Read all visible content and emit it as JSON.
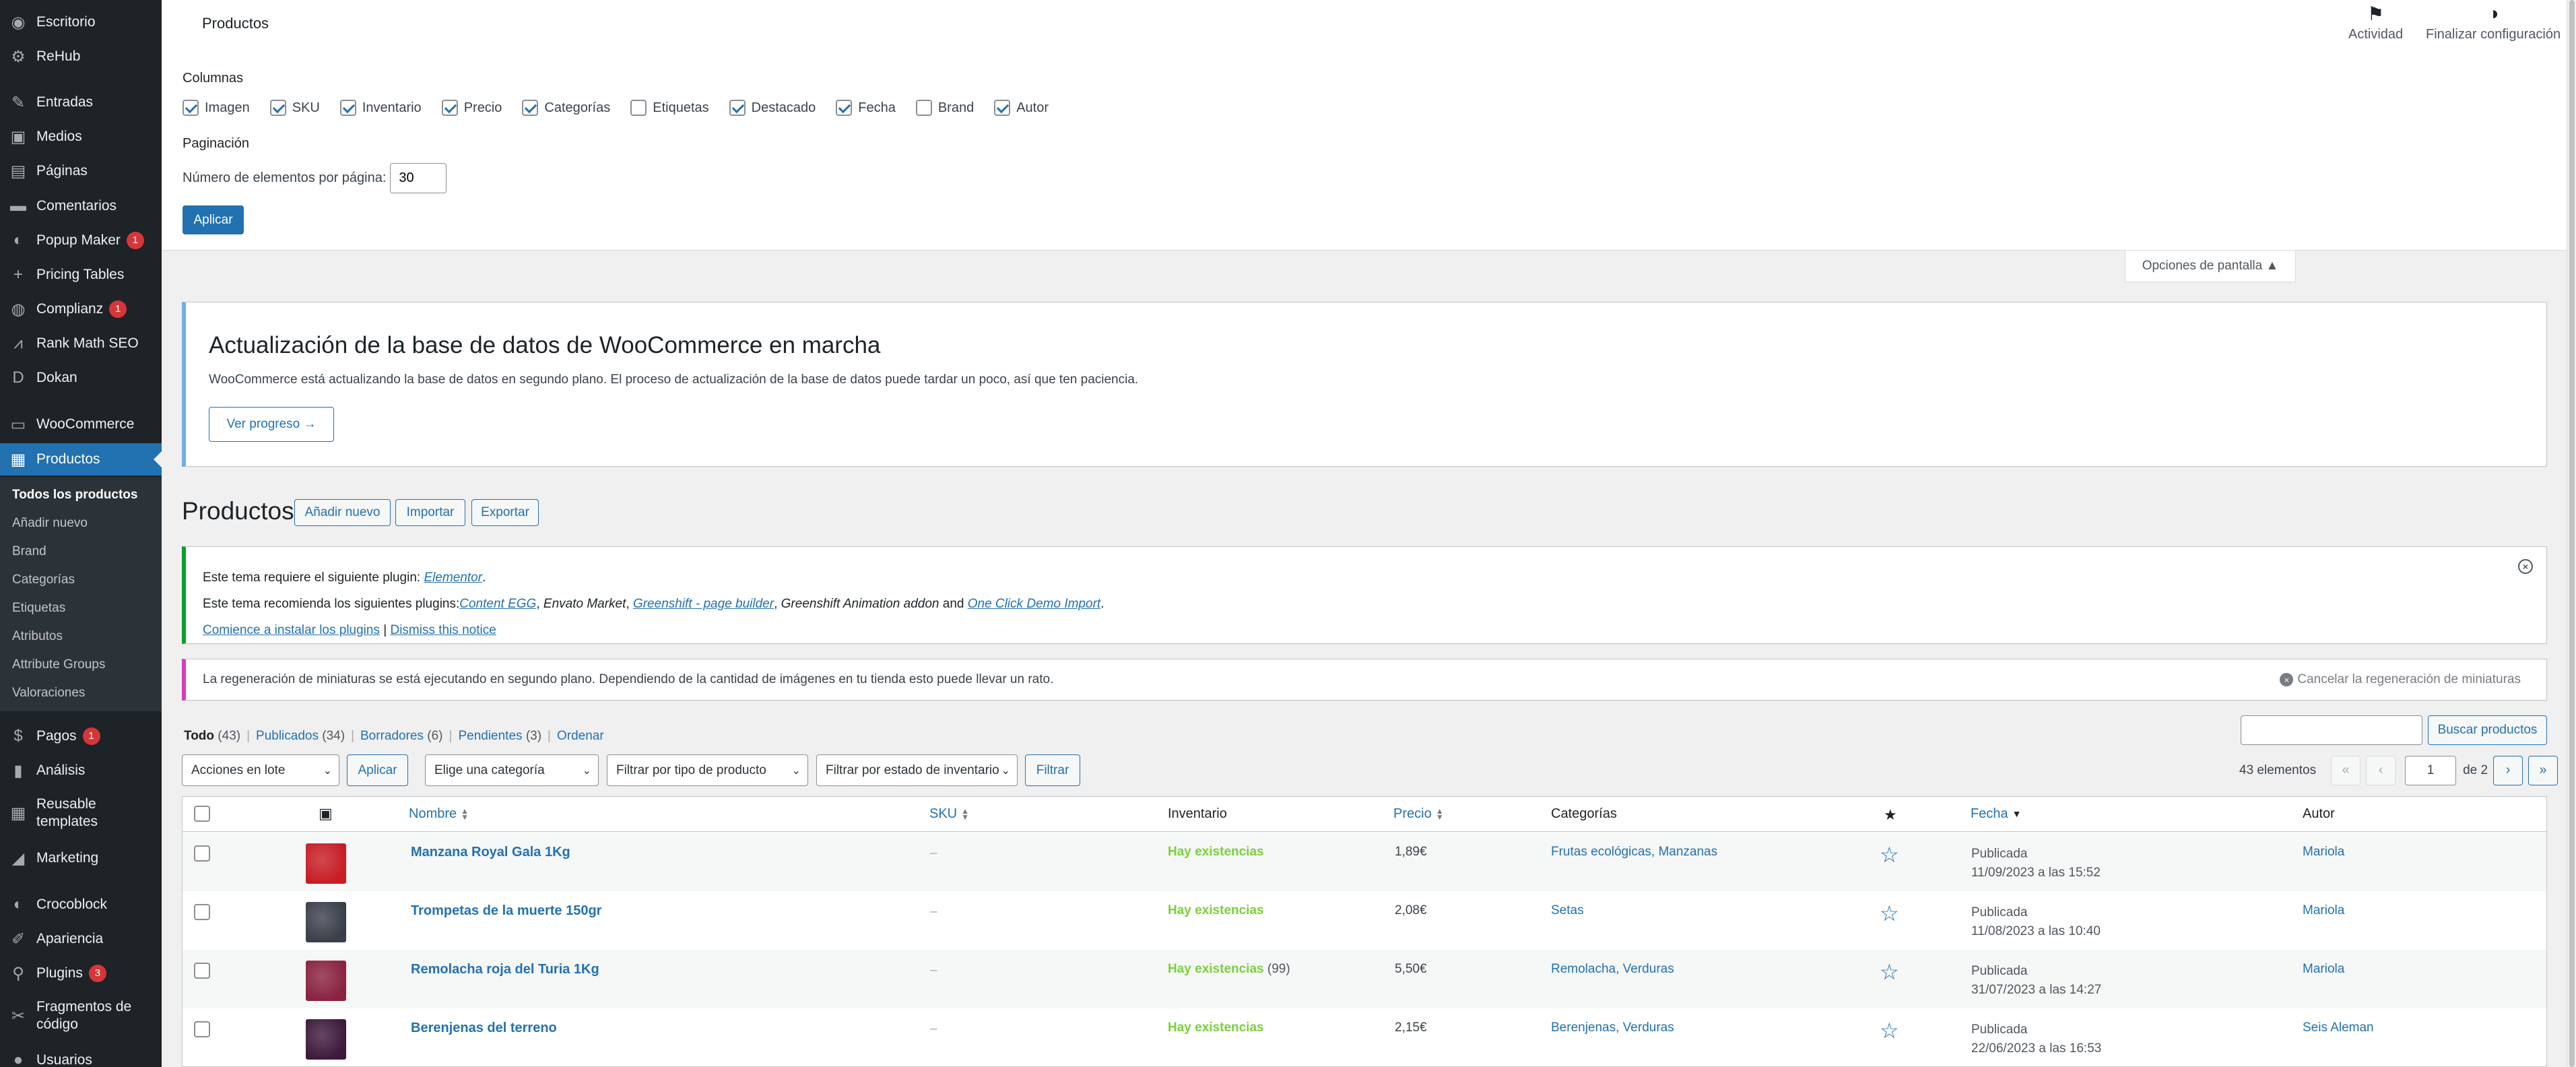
{
  "sidebar": {
    "items": [
      {
        "label": "Escritorio",
        "icon": "dashboard-icon",
        "badge": null
      },
      {
        "label": "ReHub",
        "icon": "gear-icon",
        "badge": null
      },
      {
        "label": "Entradas",
        "icon": "pin-icon",
        "badge": null
      },
      {
        "label": "Medios",
        "icon": "media-icon",
        "badge": null
      },
      {
        "label": "Páginas",
        "icon": "page-icon",
        "badge": null
      },
      {
        "label": "Comentarios",
        "icon": "comment-icon",
        "badge": null
      },
      {
        "label": "Popup Maker",
        "icon": "popup-icon",
        "badge": "1"
      },
      {
        "label": "Pricing Tables",
        "icon": "plus-icon",
        "badge": null
      },
      {
        "label": "Complianz",
        "icon": "shield-icon",
        "badge": "1"
      },
      {
        "label": "Rank Math SEO",
        "icon": "chart-icon",
        "badge": null
      },
      {
        "label": "Dokan",
        "icon": "dokan-icon",
        "badge": null
      },
      {
        "label": "WooCommerce",
        "icon": "woo-icon",
        "badge": null
      },
      {
        "label": "Productos",
        "icon": "box-icon",
        "badge": null
      },
      {
        "label": "Pagos",
        "icon": "dollar-icon",
        "badge": "1"
      },
      {
        "label": "Análisis",
        "icon": "bar-chart-icon",
        "badge": null
      },
      {
        "label": "Reusable templates",
        "icon": "grid-icon",
        "badge": null
      },
      {
        "label": "Marketing",
        "icon": "megaphone-icon",
        "badge": null
      },
      {
        "label": "Crocoblock",
        "icon": "crocoblock-icon",
        "badge": null
      },
      {
        "label": "Apariencia",
        "icon": "brush-icon",
        "badge": null
      },
      {
        "label": "Plugins",
        "icon": "plug-icon",
        "badge": "3"
      },
      {
        "label": "Fragmentos de código",
        "icon": "scissors-icon",
        "badge": null
      },
      {
        "label": "Usuarios",
        "icon": "user-icon",
        "badge": null
      }
    ],
    "submenu": [
      "Todos los productos",
      "Añadir nuevo",
      "Brand",
      "Categorías",
      "Etiquetas",
      "Atributos",
      "Attribute Groups",
      "Valoraciones"
    ]
  },
  "screen_options": {
    "page_title": "Productos",
    "columns_heading": "Columnas",
    "columns": [
      {
        "label": "Imagen",
        "checked": true
      },
      {
        "label": "SKU",
        "checked": true
      },
      {
        "label": "Inventario",
        "checked": true
      },
      {
        "label": "Precio",
        "checked": true
      },
      {
        "label": "Categorías",
        "checked": true
      },
      {
        "label": "Etiquetas",
        "checked": false
      },
      {
        "label": "Destacado",
        "checked": true
      },
      {
        "label": "Fecha",
        "checked": true
      },
      {
        "label": "Brand",
        "checked": false
      },
      {
        "label": "Autor",
        "checked": true
      }
    ],
    "pagination_heading": "Paginación",
    "per_page_label": "Número de elementos por página:",
    "per_page_value": "30",
    "apply_label": "Aplicar",
    "tab_label": "Opciones de pantalla ▲"
  },
  "top_actions": {
    "activity_label": "Actividad",
    "finish_label": "Finalizar configuración"
  },
  "db_notice": {
    "title": "Actualización de la base de datos de WooCommerce en marcha",
    "text": "WooCommerce está actualizando la base de datos en segundo plano. El proceso de actualización de la base de datos puede tardar un poco, así que ten paciencia.",
    "button": "Ver progreso →"
  },
  "header": {
    "title": "Productos",
    "add_new": "Añadir nuevo",
    "import": "Importar",
    "export": "Exportar"
  },
  "plugin_notice": {
    "line1_prefix": "Este tema requiere el siguiente plugin: ",
    "line1_link": "Elementor",
    "line2_prefix": "Este tema recomienda los siguientes plugins:",
    "line2_link1": "Content EGG",
    "line2_sep1": ", ",
    "line2_text1": "Envato Market",
    "line2_sep2": ", ",
    "line2_link2": "Greenshift - page builder",
    "line2_sep3": ", ",
    "line2_text2": "Greenshift Animation addon",
    "line2_and": " and ",
    "line2_link3": "One Click Demo Import",
    "line2_end": ".",
    "install_link": "Comience a instalar los plugins",
    "dismiss_link": "Dismiss this notice"
  },
  "regen_notice": {
    "text": "La regeneración de miniaturas se está ejecutando en segundo plano. Dependiendo de la cantidad de imágenes en tu tienda esto puede llevar un rato.",
    "cancel": "Cancelar la regeneración de miniaturas"
  },
  "filters": {
    "views": [
      {
        "label": "Todo",
        "count": "(43)"
      },
      {
        "label": "Publicados",
        "count": "(34)"
      },
      {
        "label": "Borradores",
        "count": "(6)"
      },
      {
        "label": "Pendientes",
        "count": "(3)"
      },
      {
        "label": "Ordenar",
        "count": ""
      }
    ],
    "search_button": "Buscar productos",
    "bulk_actions": "Acciones en lote",
    "apply": "Aplicar",
    "category": "Elige una categoría",
    "product_type": "Filtrar por tipo de producto",
    "stock_status": "Filtrar por estado de inventario",
    "filter_button": "Filtrar",
    "items_count": "43 elementos",
    "current_page": "1",
    "of_pages": "de 2"
  },
  "table": {
    "headers": {
      "name": "Nombre",
      "sku": "SKU",
      "stock": "Inventario",
      "price": "Precio",
      "categories": "Categorías",
      "date": "Fecha",
      "author": "Autor"
    },
    "rows": [
      {
        "name": "Manzana Royal Gala 1Kg",
        "sku": "–",
        "stock": "Hay existencias",
        "qty": "",
        "price": "1,89€",
        "categories": "Frutas ecológicas, Manzanas",
        "status": "Publicada",
        "date": "11/09/2023 a las 15:52",
        "author": "Mariola",
        "thumb_color": "#c81d25"
      },
      {
        "name": "Trompetas de la muerte 150gr",
        "sku": "–",
        "stock": "Hay existencias",
        "qty": "",
        "price": "2,08€",
        "categories": "Setas",
        "status": "Publicada",
        "date": "11/08/2023 a las 10:40",
        "author": "Mariola",
        "thumb_color": "#3a3f4b"
      },
      {
        "name": "Remolacha roja del Turia 1Kg",
        "sku": "–",
        "stock": "Hay existencias",
        "qty": "(99)",
        "price": "5,50€",
        "categories": "Remolacha, Verduras",
        "status": "Publicada",
        "date": "31/07/2023 a las 14:27",
        "author": "Mariola",
        "thumb_color": "#8a2340"
      },
      {
        "name": "Berenjenas del terreno",
        "sku": "–",
        "stock": "Hay existencias",
        "qty": "",
        "price": "2,15€",
        "categories": "Berenjenas, Verduras",
        "status": "Publicada",
        "date": "22/06/2023 a las 16:53",
        "author": "Seis Aleman",
        "thumb_color": "#3d1a3c"
      }
    ]
  }
}
